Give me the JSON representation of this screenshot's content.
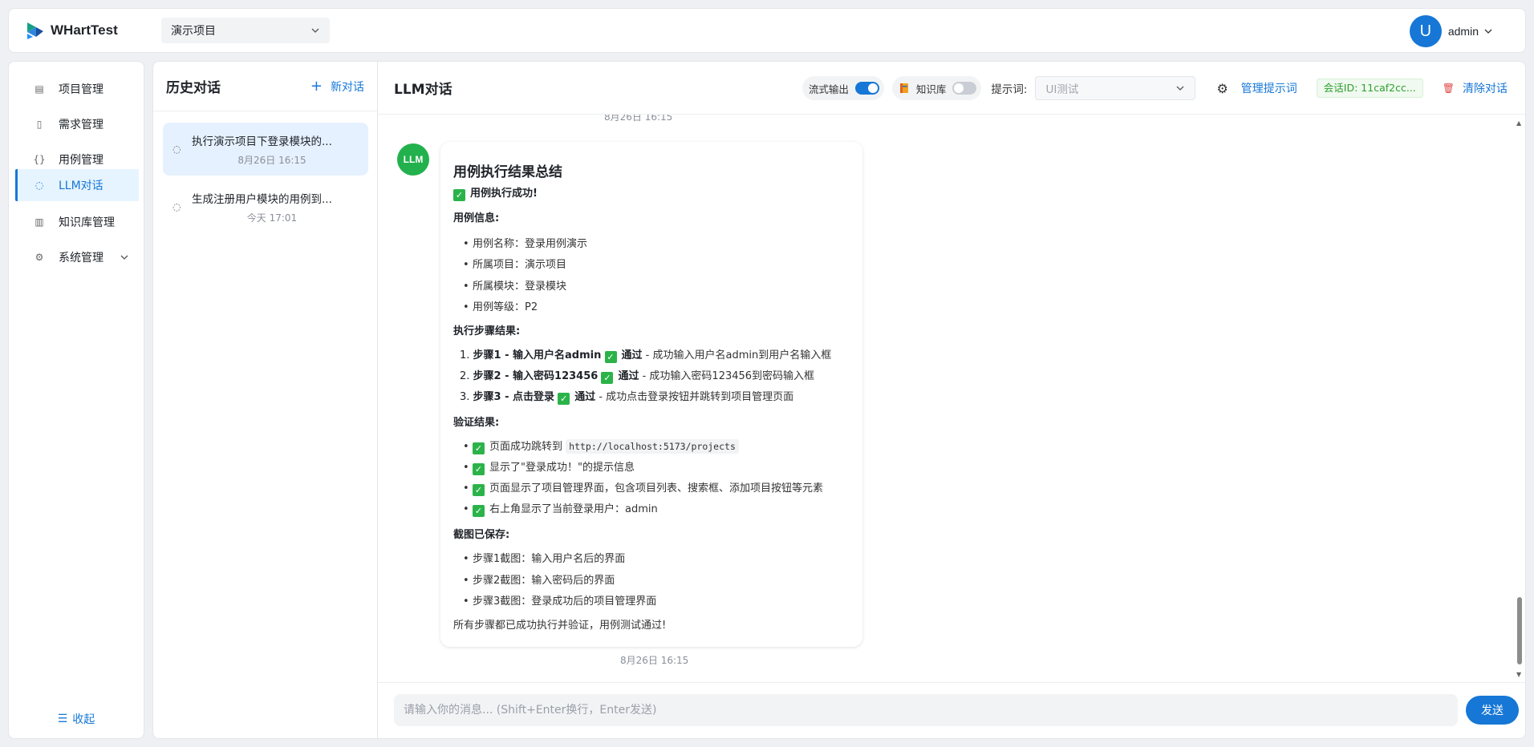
{
  "app": {
    "brand": "WHartTest",
    "project_selected": "演示项目",
    "user_initial": "U",
    "user_name": "admin"
  },
  "sidebar": {
    "items": [
      {
        "label": "项目管理",
        "icon": "project-icon"
      },
      {
        "label": "需求管理",
        "icon": "document-icon"
      },
      {
        "label": "用例管理",
        "icon": "braces-icon"
      },
      {
        "label": "LLM对话",
        "icon": "chat-icon",
        "active": true
      },
      {
        "label": "知识库管理",
        "icon": "book-icon"
      },
      {
        "label": "系统管理",
        "icon": "gear-icon"
      }
    ],
    "collapse_label": "收起"
  },
  "history": {
    "title": "历史对话",
    "new_chat_label": "新对话",
    "conversations": [
      {
        "title": "执行演示项目下登录模块的...",
        "time": "8月26日 16:15",
        "active": true
      },
      {
        "title": "生成注册用户模块的用例到...",
        "time": "今天 17:01",
        "active": false
      }
    ]
  },
  "chat": {
    "title": "LLM对话",
    "stream_label": "流式输出",
    "stream_on": true,
    "kb_label": "知识库",
    "kb_on": false,
    "prompt_label": "提示词:",
    "prompt_value": "UI测试",
    "manage_prompt_label": "管理提示词",
    "session_tag": "会话ID: 11caf2cc...",
    "clear_label": "清除对话",
    "prev_time": "8月26日 16:15",
    "bot_avatar": "LLM",
    "bot_time": "8月26日 16:15",
    "message": {
      "heading": "用例执行结果总结",
      "success_line": "用例执行成功!",
      "info_title": "用例信息:",
      "info_items": [
        "用例名称：登录用例演示",
        "所属项目：演示项目",
        "所属模块：登录模块",
        "用例等级：P2"
      ],
      "steps_title": "执行步骤结果:",
      "steps": [
        {
          "no": "1.",
          "step": "步骤1 - 输入用户名admin",
          "status": "通过",
          "detail": " - 成功输入用户名admin到用户名输入框"
        },
        {
          "no": "2.",
          "step": "步骤2 - 输入密码123456",
          "status": "通过",
          "detail": " - 成功输入密码123456到密码输入框"
        },
        {
          "no": "3.",
          "step": "步骤3 - 点击登录",
          "status": "通过",
          "detail": " - 成功点击登录按钮并跳转到项目管理页面"
        }
      ],
      "verify_title": "验证结果:",
      "verify_1_prefix": "页面成功跳转到",
      "verify_1_code": "http://localhost:5173/projects",
      "verify_2": "显示了\"登录成功！\"的提示信息",
      "verify_3": "页面显示了项目管理界面，包含项目列表、搜索框、添加项目按钮等元素",
      "verify_4": "右上角显示了当前登录用户：admin",
      "shots_title": "截图已保存:",
      "shots": [
        "步骤1截图：输入用户名后的界面",
        "步骤2截图：输入密码后的界面",
        "步骤3截图：登录成功后的项目管理界面"
      ],
      "footer": "所有步骤都已成功执行并验证，用例测试通过!"
    },
    "input_placeholder": "请输入你的消息... (Shift+Enter换行，Enter发送)",
    "send_label": "发送"
  },
  "colors": {
    "primary": "#1677d6",
    "success": "#2bb34a",
    "danger": "#e04848"
  }
}
